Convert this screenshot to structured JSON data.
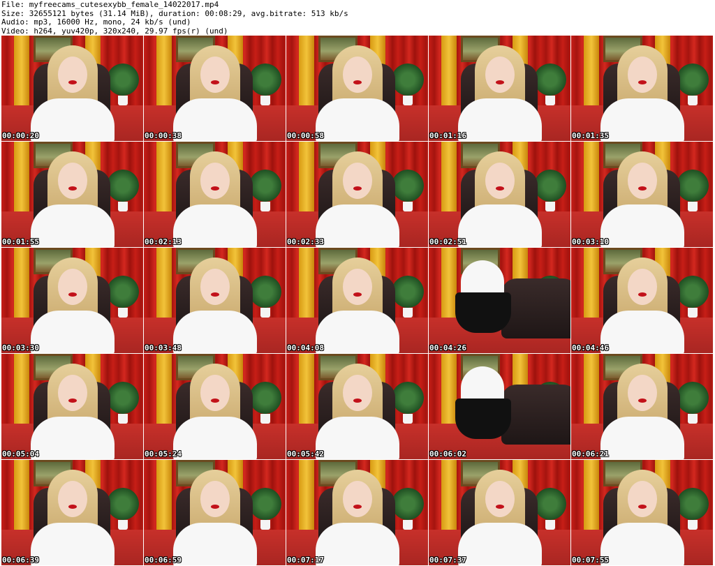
{
  "header": {
    "file": "File: myfreecams_cutesexybb_female_14022017.mp4",
    "size": "Size: 32655121 bytes (31.14 MiB), duration: 00:08:29, avg.bitrate: 513 kb/s",
    "audio": "Audio: mp3, 16000 Hz, mono, 24 kb/s (und)",
    "video": "Video: h264, yuv420p, 320x240, 29.97 fps(r) (und)"
  },
  "frames": [
    {
      "timestamp": "00:00:20",
      "pose": "seated"
    },
    {
      "timestamp": "00:00:38",
      "pose": "seated"
    },
    {
      "timestamp": "00:00:58",
      "pose": "seated"
    },
    {
      "timestamp": "00:01:16",
      "pose": "seated"
    },
    {
      "timestamp": "00:01:35",
      "pose": "seated"
    },
    {
      "timestamp": "00:01:55",
      "pose": "seated"
    },
    {
      "timestamp": "00:02:13",
      "pose": "seated"
    },
    {
      "timestamp": "00:02:33",
      "pose": "seated"
    },
    {
      "timestamp": "00:02:51",
      "pose": "seated"
    },
    {
      "timestamp": "00:03:10",
      "pose": "seated"
    },
    {
      "timestamp": "00:03:30",
      "pose": "seated"
    },
    {
      "timestamp": "00:03:48",
      "pose": "seated"
    },
    {
      "timestamp": "00:04:08",
      "pose": "seated"
    },
    {
      "timestamp": "00:04:26",
      "pose": "standing"
    },
    {
      "timestamp": "00:04:46",
      "pose": "seated"
    },
    {
      "timestamp": "00:05:04",
      "pose": "seated"
    },
    {
      "timestamp": "00:05:24",
      "pose": "seated"
    },
    {
      "timestamp": "00:05:42",
      "pose": "seated"
    },
    {
      "timestamp": "00:06:02",
      "pose": "standing"
    },
    {
      "timestamp": "00:06:21",
      "pose": "seated"
    },
    {
      "timestamp": "00:06:39",
      "pose": "seated"
    },
    {
      "timestamp": "00:06:59",
      "pose": "seated"
    },
    {
      "timestamp": "00:07:17",
      "pose": "seated"
    },
    {
      "timestamp": "00:07:37",
      "pose": "seated"
    },
    {
      "timestamp": "00:07:55",
      "pose": "seated"
    }
  ],
  "colors": {
    "curtain": "#c71e17",
    "gold": "#e5ad24",
    "shirt": "#f7f7f7",
    "hair": "#e6cf9b",
    "lips": "#c2111a",
    "chair": "#2a1f1e"
  }
}
